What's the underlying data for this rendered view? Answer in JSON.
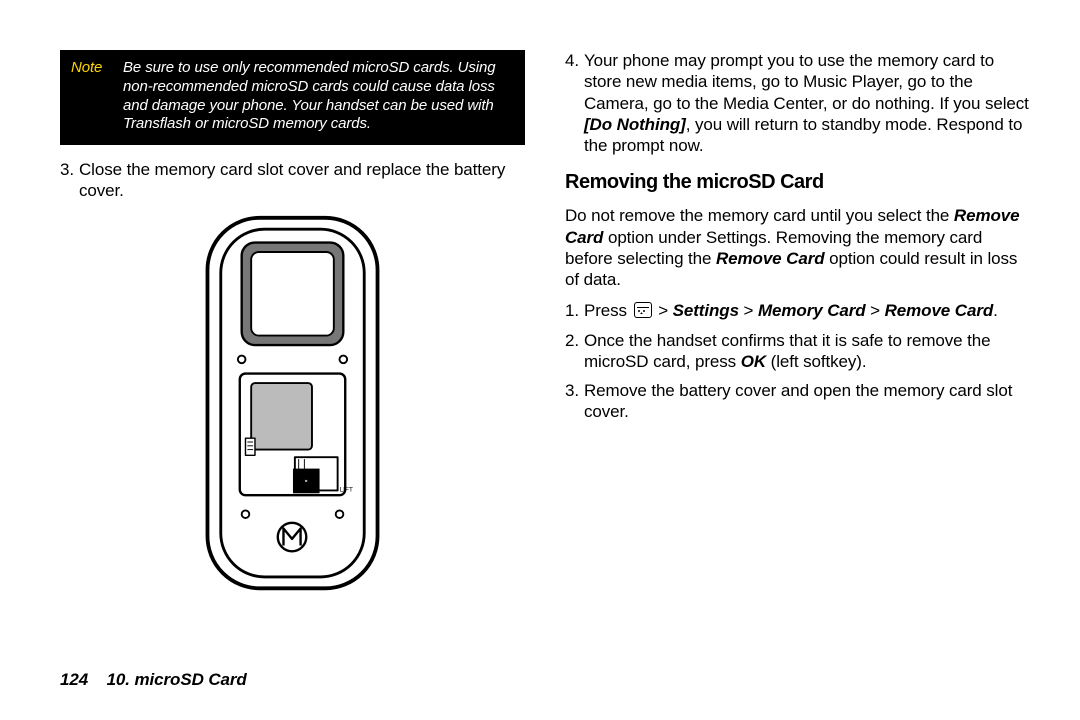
{
  "note": {
    "label": "Note",
    "text": "Be sure to use only recommended microSD cards. Using non-recommended microSD cards could cause data loss and damage your phone. Your handset can be used with Transflash or microSD memory cards."
  },
  "left": {
    "step3_num": "3.",
    "step3": "Close the memory card slot cover and replace the battery cover."
  },
  "right": {
    "step4_num": "4.",
    "step4_a": "Your phone may prompt you to use the memory card to store new media items, go to Music Player, go to the Camera, go to the Media Center, or do nothing. If you select ",
    "step4_bold": "[Do Nothing]",
    "step4_b": ", you will return to standby mode. Respond to the prompt now.",
    "heading": "Removing the microSD Card",
    "para_a": "Do not remove the memory card until you select the ",
    "para_bold1": "Remove Card",
    "para_b": " option under Settings. Removing the memory card before selecting the ",
    "para_bold2": "Remove Card",
    "para_c": " option could result in loss of data.",
    "s1_num": "1.",
    "s1_a": "Press ",
    "s1_gt1": " > ",
    "s1_b1": "Settings",
    "s1_gt2": " > ",
    "s1_b2": "Memory Card",
    "s1_gt3": " > ",
    "s1_b3": "Remove Card",
    "s1_period": ".",
    "s2_num": "2.",
    "s2_a": "Once the handset confirms that it is safe to remove the microSD card, press ",
    "s2_bold": "OK",
    "s2_b": " (left softkey).",
    "s3_num": "3.",
    "s3": "Remove the battery cover and open the memory card slot cover."
  },
  "phone": {
    "lift_label": "LIFT"
  },
  "footer": {
    "page_num": "124",
    "section": "10. microSD Card"
  }
}
